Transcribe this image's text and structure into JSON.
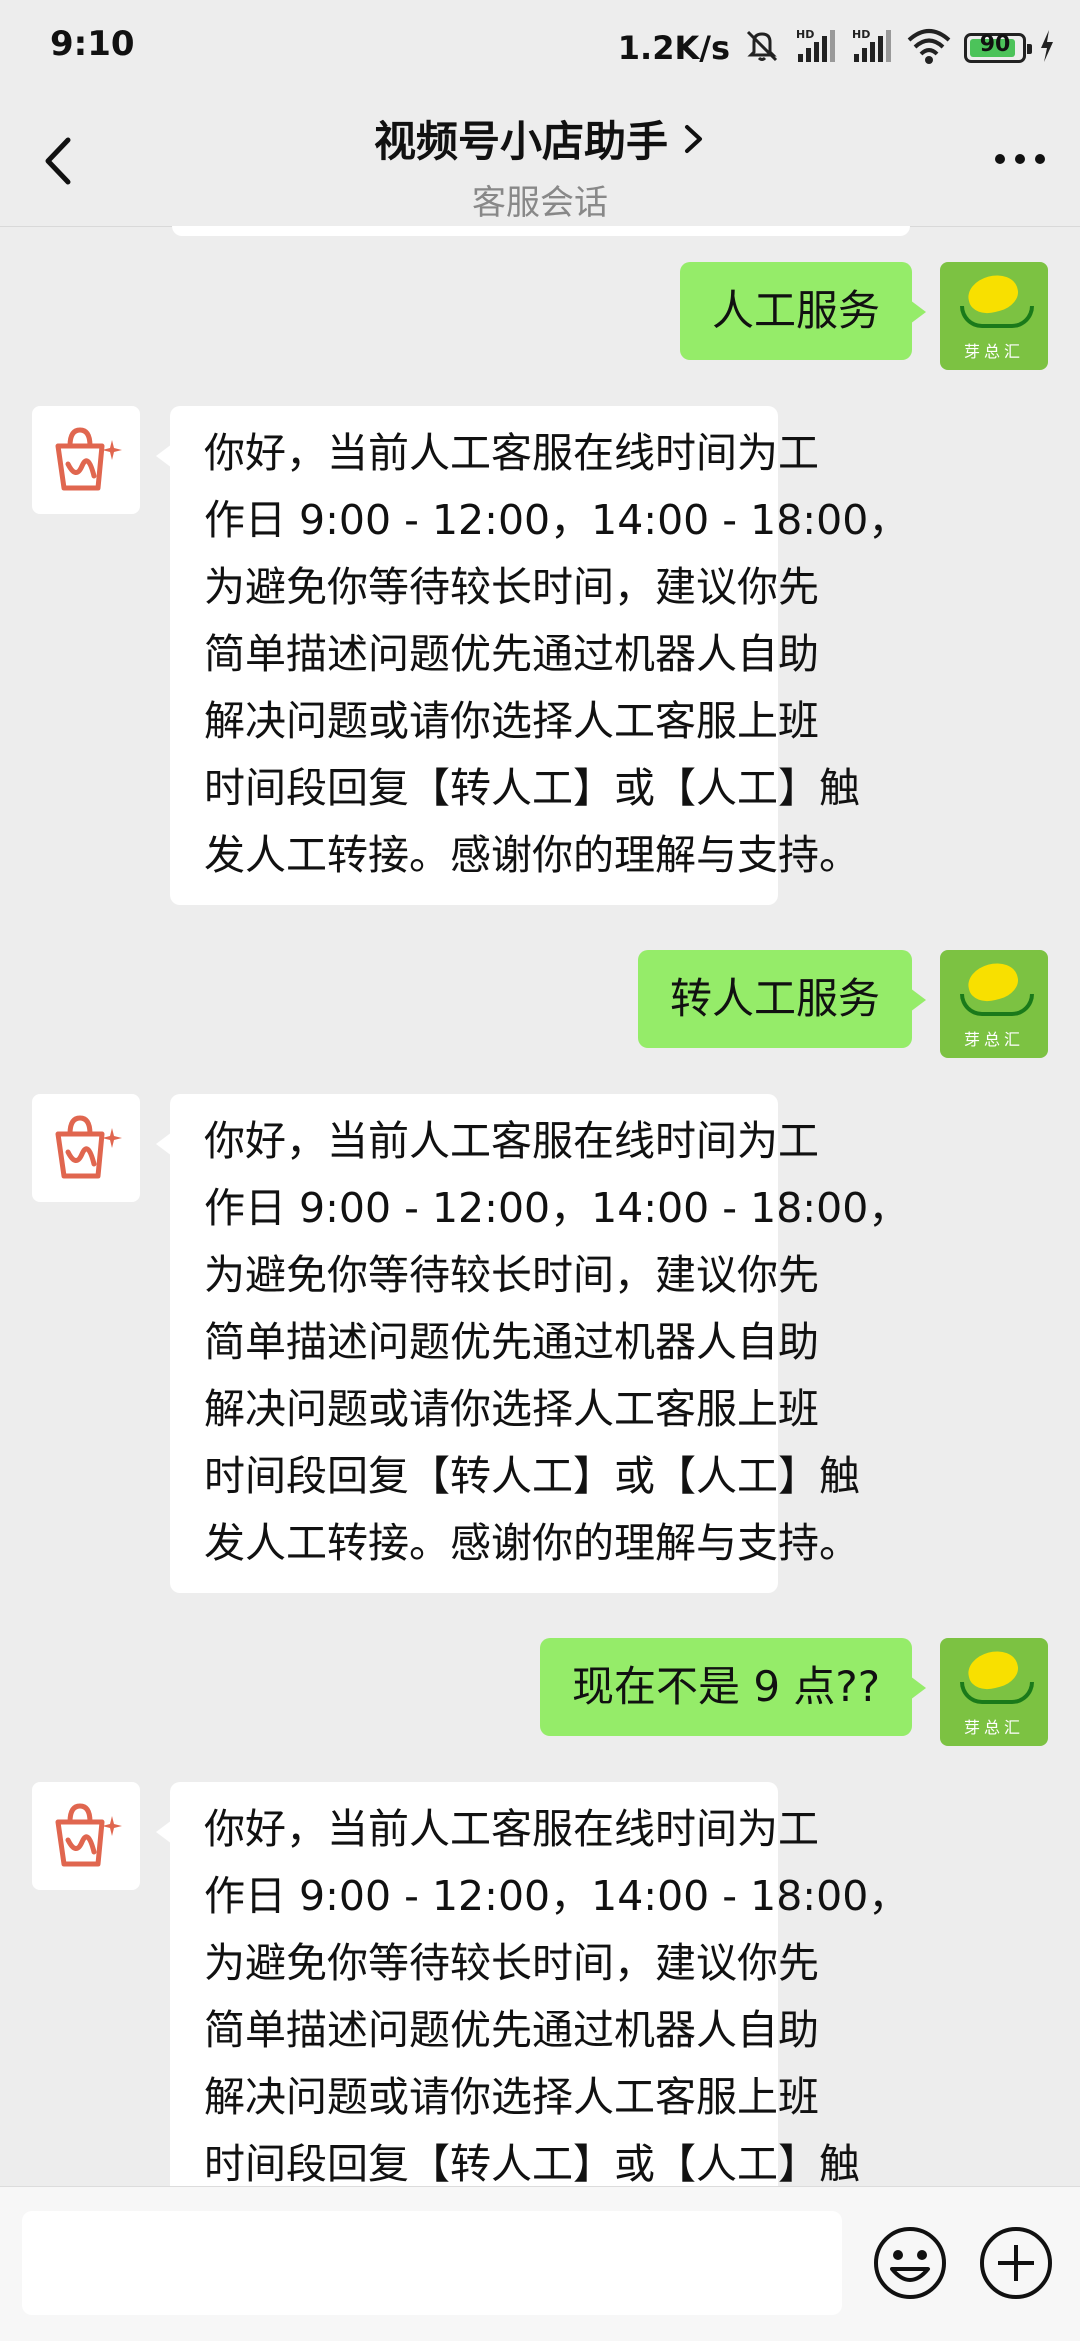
{
  "status_bar": {
    "time": "9:10",
    "net_speed": "1.2K/s",
    "battery_level": "90",
    "battery_fraction": 0.9,
    "signal_label": "HD"
  },
  "header": {
    "title": "视频号小店助手",
    "subtitle": "客服会话",
    "title_chevron": "chevron-right-icon"
  },
  "messages": [
    {
      "from": "user",
      "text": "人工服务"
    },
    {
      "from": "bot",
      "lines": [
        "你好，当前人工客服在线时间为工",
        "作日 9:00 - 12:00，14:00 - 18:00，",
        "为避免你等待较长时间，建议你先",
        "简单描述问题优先通过机器人自助",
        "解决问题或请你选择人工客服上班",
        "时间段回复【转人工】或【人工】触",
        "发人工转接。感谢你的理解与支持。"
      ]
    },
    {
      "from": "user",
      "text": "转人工服务"
    },
    {
      "from": "bot",
      "lines": [
        "你好，当前人工客服在线时间为工",
        "作日 9:00 - 12:00，14:00 - 18:00，",
        "为避免你等待较长时间，建议你先",
        "简单描述问题优先通过机器人自助",
        "解决问题或请你选择人工客服上班",
        "时间段回复【转人工】或【人工】触",
        "发人工转接。感谢你的理解与支持。"
      ]
    },
    {
      "from": "user",
      "text": "现在不是 9 点??"
    },
    {
      "from": "bot",
      "lines": [
        "你好，当前人工客服在线时间为工",
        "作日 9:00 - 12:00，14:00 - 18:00，",
        "为避免你等待较长时间，建议你先",
        "简单描述问题优先通过机器人自助",
        "解决问题或请你选择人工客服上班",
        "时间段回复【转人工】或【人工】触"
      ]
    }
  ],
  "user_avatar": {
    "label": "芽总汇"
  },
  "colors": {
    "background": "#ededed",
    "user_bubble": "#95ec69",
    "bot_bubble": "#ffffff",
    "bot_icon": "#e0664f",
    "user_avatar_bg": "#7cc242"
  },
  "input_bar": {
    "emoji_icon": "smiley-icon",
    "plus_icon": "plus-circle-icon"
  }
}
